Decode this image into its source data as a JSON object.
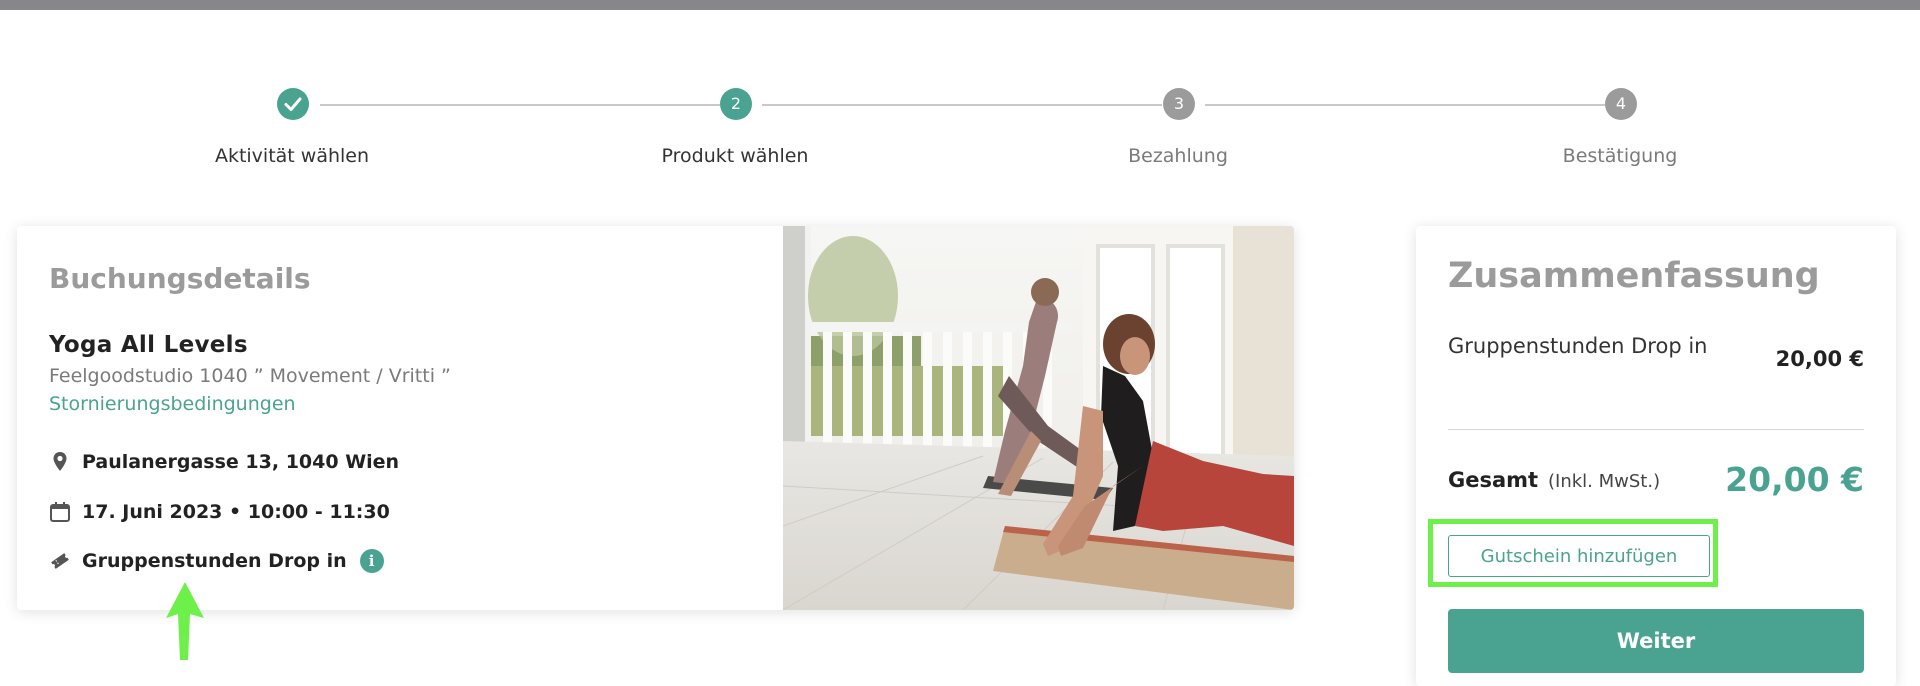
{
  "stepper": {
    "steps": [
      {
        "number": "",
        "label": "Aktivität wählen",
        "state": "done"
      },
      {
        "number": "2",
        "label": "Produkt wählen",
        "state": "active"
      },
      {
        "number": "3",
        "label": "Bezahlung",
        "state": "pending"
      },
      {
        "number": "4",
        "label": "Bestätigung",
        "state": "pending"
      }
    ]
  },
  "booking": {
    "title": "Buchungsdetails",
    "class_name": "Yoga All Levels",
    "studio": "Feelgoodstudio 1040 ” Movement / Vritti ”",
    "cancellation_link": "Stornierungsbedingungen",
    "address": "Paulanergasse 13, 1040 Wien",
    "datetime": "17. Juni 2023 • 10:00 - 11:30",
    "product": "Gruppenstunden Drop in",
    "info_icon": "i"
  },
  "summary": {
    "title": "Zusammenfassung",
    "item_name": "Gruppenstunden Drop in",
    "item_price": "20,00 €",
    "total_label": "Gesamt",
    "total_note": "(Inkl. MwSt.)",
    "total_price": "20,00 €",
    "voucher_button": "Gutschein hinzufügen",
    "next_button": "Weiter"
  },
  "colors": {
    "accent": "#4aa391",
    "highlight": "#6ef04a",
    "pending": "#9b9b9b"
  },
  "icons": [
    "check-icon",
    "location-pin-icon",
    "calendar-icon",
    "ticket-icon",
    "info-icon",
    "annotation-arrow"
  ]
}
